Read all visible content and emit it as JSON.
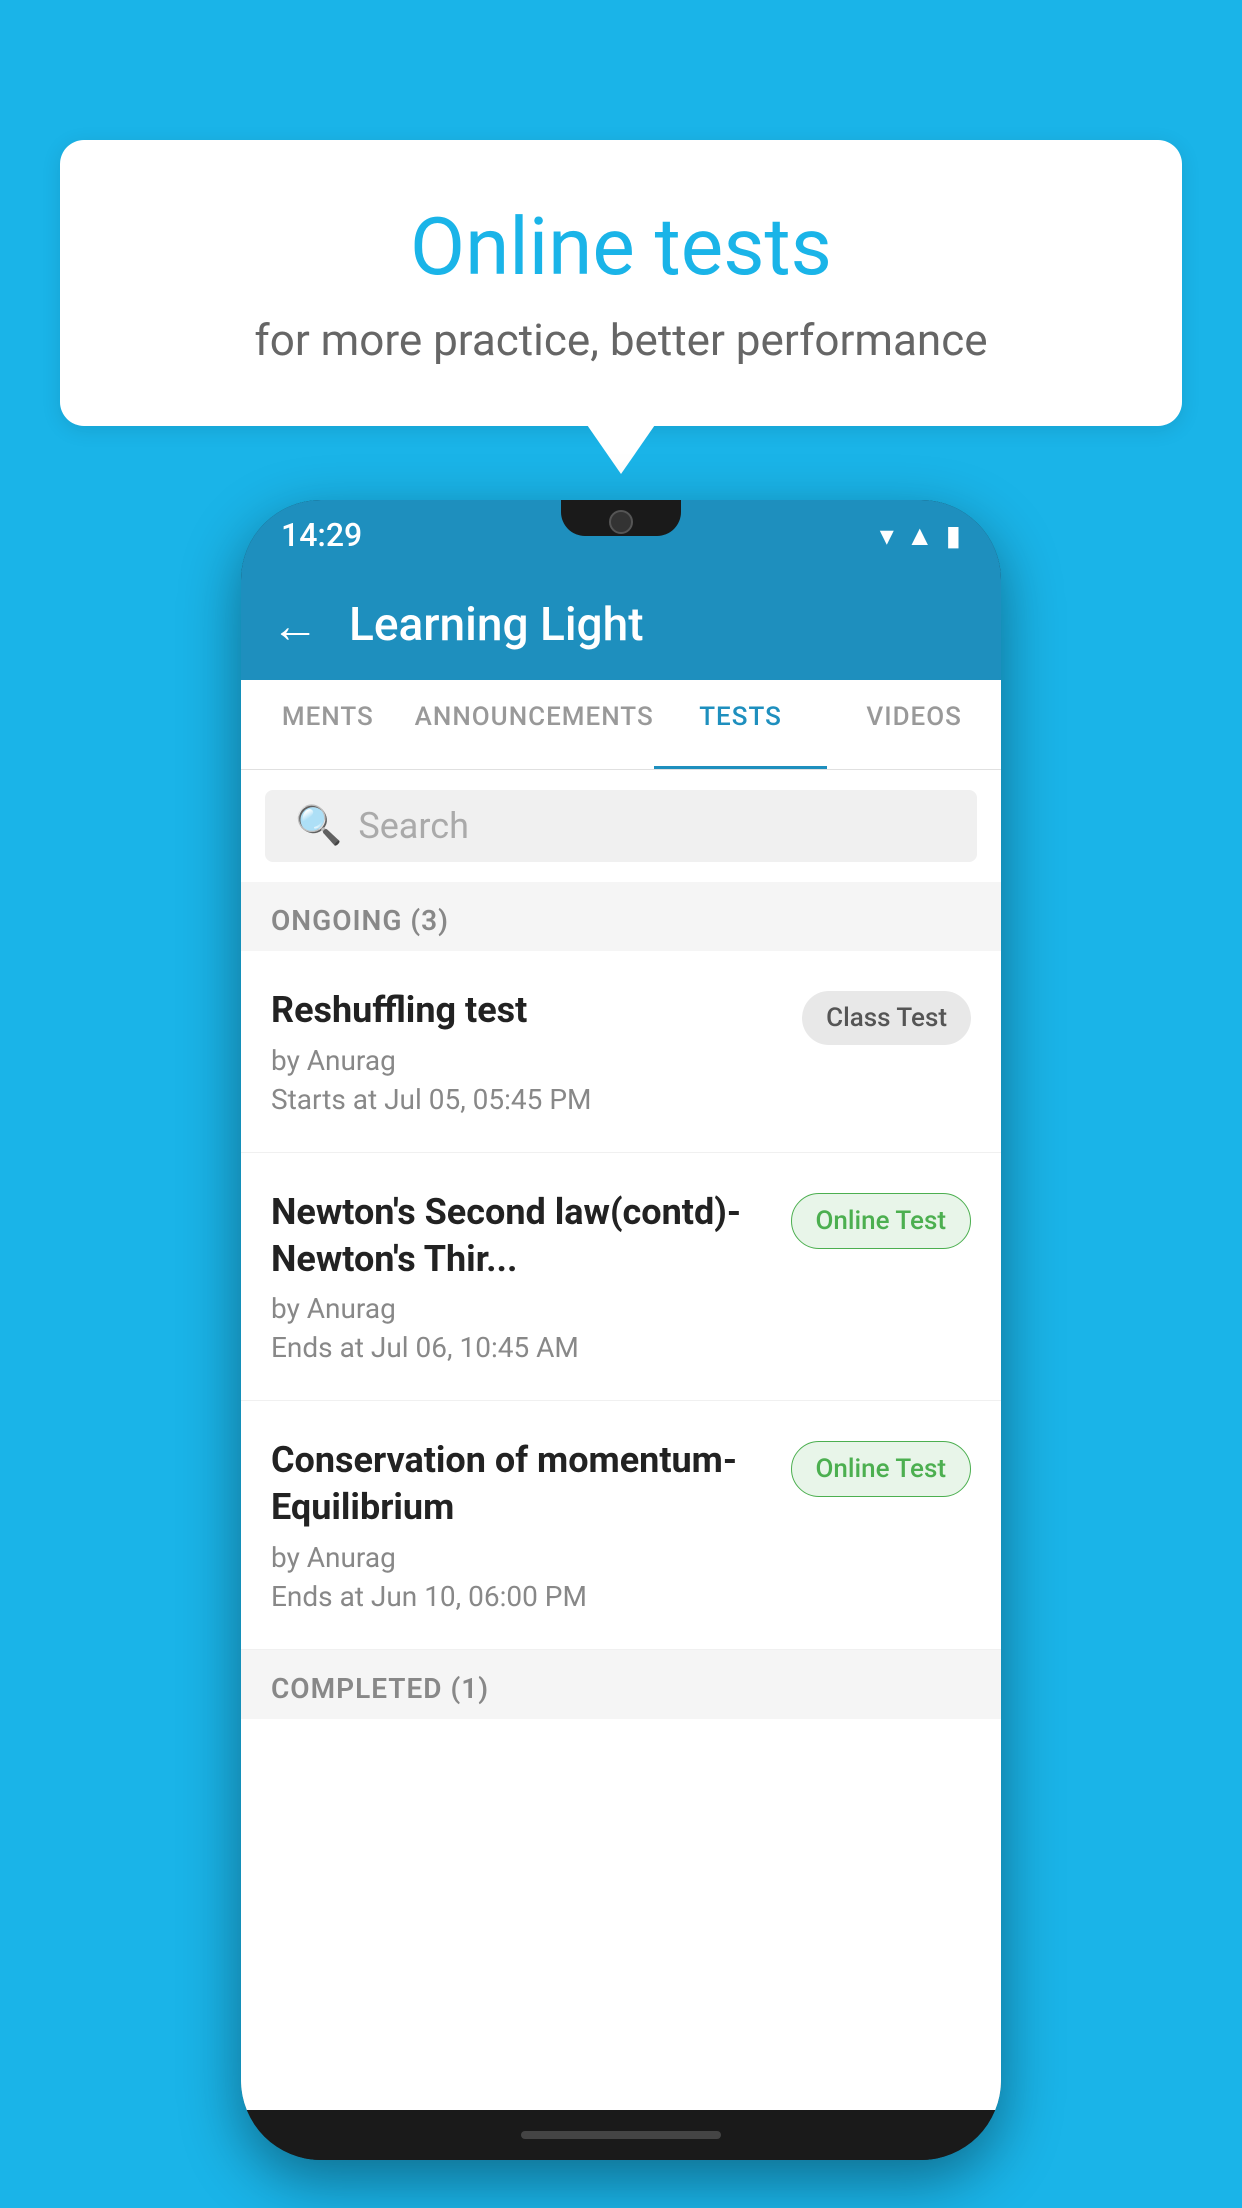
{
  "background_color": "#1ab4e8",
  "speech_bubble": {
    "title": "Online tests",
    "subtitle": "for more practice, better performance"
  },
  "phone": {
    "status_bar": {
      "time": "14:29",
      "icons": [
        "wifi",
        "signal",
        "battery"
      ]
    },
    "app_bar": {
      "title": "Learning Light",
      "back_label": "←"
    },
    "tabs": [
      {
        "label": "MENTS",
        "active": false
      },
      {
        "label": "ANNOUNCEMENTS",
        "active": false
      },
      {
        "label": "TESTS",
        "active": true
      },
      {
        "label": "VIDEOS",
        "active": false
      }
    ],
    "search": {
      "placeholder": "Search"
    },
    "ongoing_section": {
      "label": "ONGOING (3)"
    },
    "tests": [
      {
        "name": "Reshuffling test",
        "author": "by Anurag",
        "date": "Starts at  Jul 05, 05:45 PM",
        "badge_label": "Class Test",
        "badge_type": "class"
      },
      {
        "name": "Newton's Second law(contd)-Newton's Thir...",
        "author": "by Anurag",
        "date": "Ends at  Jul 06, 10:45 AM",
        "badge_label": "Online Test",
        "badge_type": "online"
      },
      {
        "name": "Conservation of momentum-Equilibrium",
        "author": "by Anurag",
        "date": "Ends at  Jun 10, 06:00 PM",
        "badge_label": "Online Test",
        "badge_type": "online"
      }
    ],
    "completed_section": {
      "label": "COMPLETED (1)"
    }
  }
}
